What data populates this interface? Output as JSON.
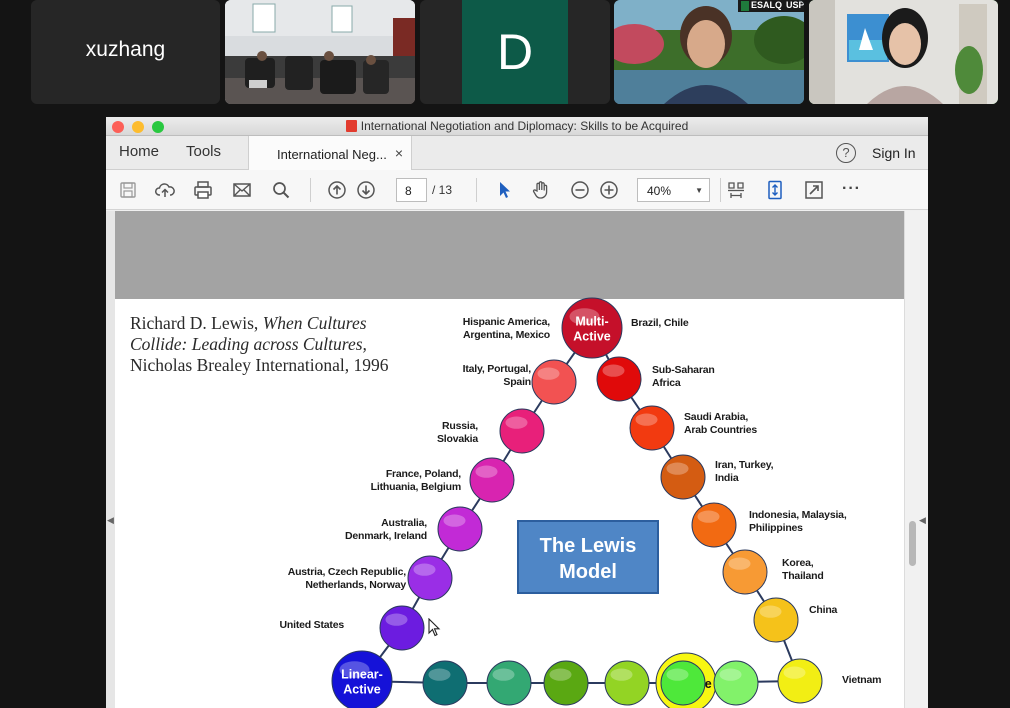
{
  "participants": [
    {
      "name": "xuzhang"
    },
    {
      "initial": "D"
    },
    {
      "badge_left": "ESALQ",
      "badge_right": "USP"
    }
  ],
  "window": {
    "title": "International Negotiation and Diplomacy: Skills  to be Acquired"
  },
  "tabs": {
    "home": "Home",
    "tools": "Tools",
    "document": "International Neg...",
    "close": "×",
    "help": "?",
    "sign_in": "Sign In"
  },
  "toolbar": {
    "current_page": "8",
    "page_total": "/  13",
    "zoom": "40%",
    "more": "···"
  },
  "document": {
    "citation": {
      "author": "Richard D. Lewis,",
      "book_title": "When Cultures Collide: Leading across Cultures,",
      "publisher": "Nicholas Brealey International,",
      "year": "1996"
    },
    "model_title": [
      "The Lewis",
      "Model"
    ],
    "nodes": [
      {
        "label": [
          "Linear-",
          "Active"
        ],
        "color": "#1512d8",
        "countries": []
      },
      {
        "label": [],
        "color": "#6c1ce0",
        "countries": [
          "United States"
        ]
      },
      {
        "label": [],
        "color": "#9a2ee6",
        "countries": [
          "Austria, Czech Republic,",
          "Netherlands, Norway"
        ]
      },
      {
        "label": [],
        "color": "#c22ad6",
        "countries": [
          "Australia,",
          "Denmark, Ireland"
        ]
      },
      {
        "label": [],
        "color": "#d824b0",
        "countries": [
          "France, Poland,",
          "Lithuania, Belgium"
        ]
      },
      {
        "label": [],
        "color": "#e8207a",
        "countries": [
          "Russia,",
          "Slovakia"
        ]
      },
      {
        "label": [],
        "color": "#f25252",
        "countries": [
          "Italy, Portugal,",
          "Spain"
        ]
      },
      {
        "label": [
          "Multi-",
          "Active"
        ],
        "color": "#c5102a",
        "countries": [
          "Hispanic America,",
          "Argentina, Mexico"
        ]
      },
      {
        "label": [],
        "color": "#e00a0a",
        "countries": [
          "Brazil, Chile"
        ]
      },
      {
        "label": [],
        "color": "#f23a10",
        "countries": [
          "Sub-Saharan",
          "Africa"
        ]
      },
      {
        "label": [],
        "color": "#d45c12",
        "countries": [
          "Saudi Arabia,",
          "Arab Countries"
        ]
      },
      {
        "label": [],
        "color": "#f26a12",
        "countries": [
          "Iran, Turkey,",
          "India"
        ]
      },
      {
        "label": [],
        "color": "#f79a34",
        "countries": [
          "Indonesia, Malaysia,",
          "Philippines"
        ]
      },
      {
        "label": [],
        "color": "#f5c21a",
        "countries": [
          "Korea,",
          "Thailand"
        ]
      },
      {
        "label": [],
        "color": "#f2ee14",
        "countries": [
          "China"
        ]
      },
      {
        "label": [
          "Reactive"
        ],
        "color": "#f7f712",
        "countries": [
          "Vietnam"
        ]
      },
      {
        "label": [],
        "color": "#82f26a",
        "countries": []
      },
      {
        "label": [],
        "color": "#4ee83a",
        "countries": []
      },
      {
        "label": [],
        "color": "#93d424",
        "countries": []
      },
      {
        "label": [],
        "color": "#5aa812",
        "countries": []
      },
      {
        "label": [],
        "color": "#33a873",
        "countries": []
      },
      {
        "label": [],
        "color": "#0f6e72",
        "countries": []
      }
    ]
  }
}
